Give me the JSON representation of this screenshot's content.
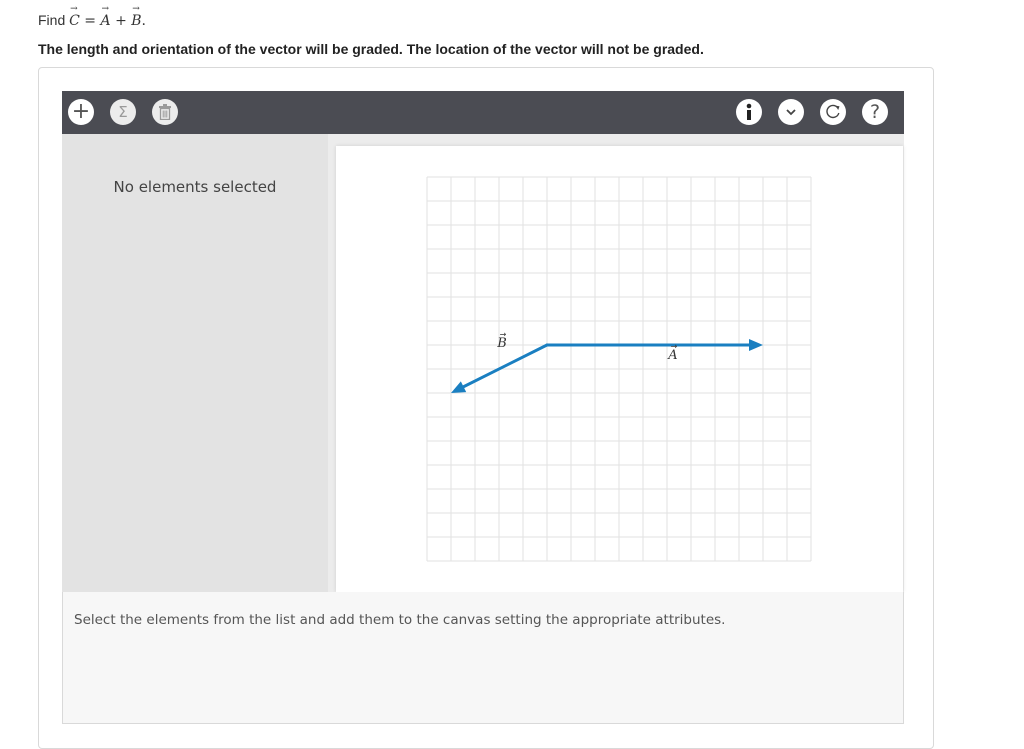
{
  "prompt": {
    "prefix": "Find",
    "c": "C",
    "eq": "=",
    "a": "A",
    "plus": "+",
    "b": "B",
    "suffix": "."
  },
  "instructions": "The length and orientation of the vector will be graded. The location of the vector will not be graded.",
  "toolbar": {
    "left_buttons": [
      "add-icon",
      "sigma-icon",
      "trash-icon"
    ],
    "right_buttons": [
      "info-icon",
      "chevron-down-icon",
      "reset-icon",
      "help-icon"
    ],
    "add_glyph": "+",
    "sigma_glyph": "Σ",
    "help_glyph": "?"
  },
  "left_panel": {
    "message": "No elements selected"
  },
  "canvas": {
    "grid_columns": 16,
    "grid_rows": 16,
    "vector_color": "#1a7fc1",
    "vectors": [
      {
        "name": "A",
        "label": "A",
        "from": [
          5,
          7
        ],
        "to": [
          14,
          7
        ]
      },
      {
        "name": "B",
        "label": "B",
        "from": [
          5,
          7
        ],
        "to": [
          1,
          9
        ]
      }
    ]
  },
  "bottom_panel": {
    "hint": "Select the elements from the list and add them to the canvas setting the appropriate attributes."
  }
}
